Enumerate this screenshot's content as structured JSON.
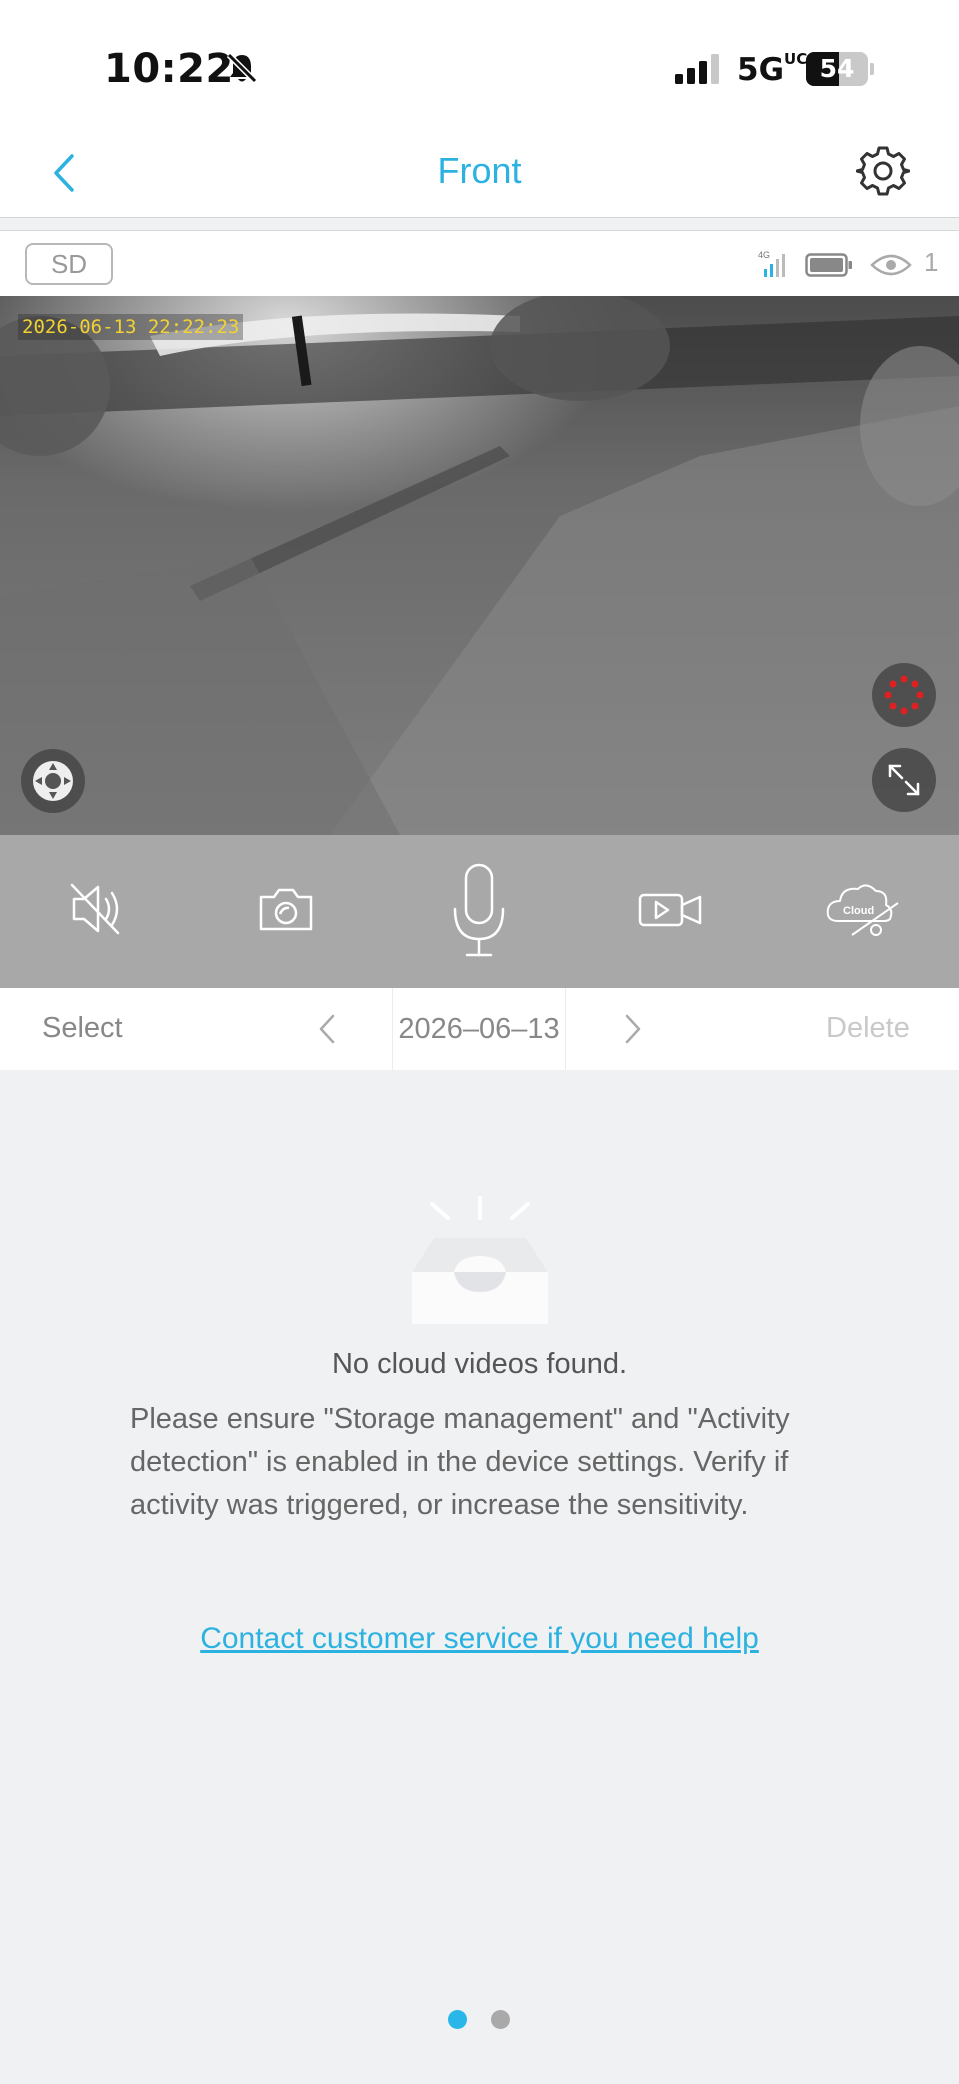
{
  "status_bar": {
    "time": "10:22",
    "network": "5G",
    "network_suffix": "UC",
    "battery_level": "54",
    "battery_fraction": 0.54
  },
  "header": {
    "title": "Front",
    "back_icon": "chevron-left-icon",
    "settings_icon": "gear-icon"
  },
  "camera_bar": {
    "storage_badge": "SD",
    "signal_label": "4G",
    "viewer_count": "1"
  },
  "video": {
    "timestamp": "2026-06-13 22:22:23"
  },
  "controls": [
    {
      "name": "mute",
      "icon": "speaker-muted-icon"
    },
    {
      "name": "snapshot",
      "icon": "camera-icon"
    },
    {
      "name": "talk",
      "icon": "microphone-icon"
    },
    {
      "name": "record",
      "icon": "video-camera-icon"
    },
    {
      "name": "cloud",
      "icon": "cloud-off-icon",
      "label": "Cloud"
    }
  ],
  "date_bar": {
    "select_label": "Select",
    "date": "2026–06–13",
    "delete_label": "Delete"
  },
  "empty_state": {
    "title": "No cloud videos found.",
    "description": "Please ensure \"Storage management\" and \"Activity detection\" is enabled in the device settings. Verify if activity was triggered, or increase the sensitivity.",
    "help_link": "Contact customer service if you need help"
  },
  "pager": {
    "pages": 2,
    "active": 0,
    "active_color": "#29b6e8",
    "inactive_color": "#a9a9a9"
  },
  "colors": {
    "accent": "#2bb2e0",
    "timestamp": "#f2d133"
  }
}
